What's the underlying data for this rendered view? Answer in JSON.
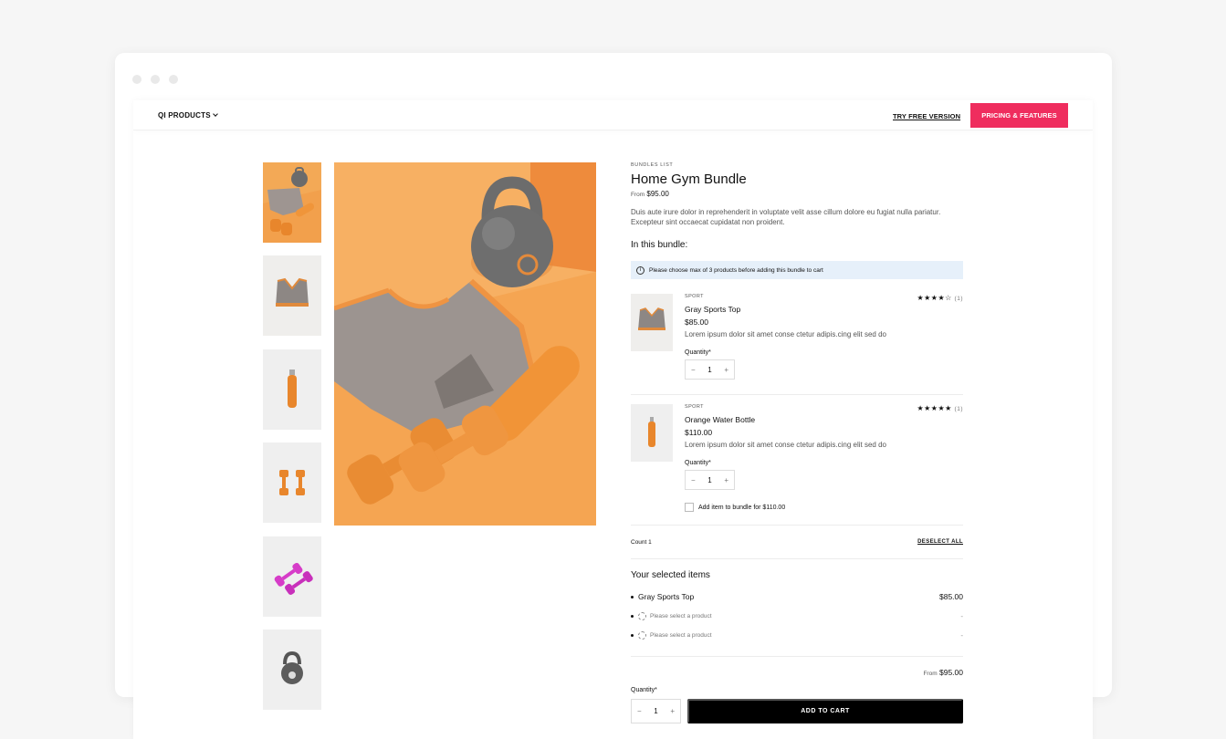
{
  "nav": {
    "products_label": "QI PRODUCTS",
    "try_free_label": "TRY FREE VERSION",
    "pricing_label": "PRICING & FEATURES",
    "accent_color": "#ef2d5e"
  },
  "gallery": {
    "thumbnails": [
      "bundle-image",
      "sports-top",
      "water-bottle",
      "orange-dumbbells",
      "pink-dumbbells",
      "kettlebell"
    ]
  },
  "product": {
    "collection": "BUNDLES LIST",
    "title": "Home Gym Bundle",
    "from_label": "From",
    "price": "$95.00",
    "description": "Duis aute irure dolor in reprehenderit in voluptate velit asse cillum dolore eu fugiat nulla pariatur. Excepteur sint occaecat cupidatat non proident.",
    "in_bundle_label": "In this bundle:",
    "notice": "Please choose max of 3 products before adding this bundle to cart"
  },
  "items": [
    {
      "category": "SPORT",
      "name": "Gray Sports Top",
      "price": "$85.00",
      "description": "Lorem ipsum dolor sit amet conse ctetur adipis.cing elit sed do",
      "quantity_label": "Quantity*",
      "quantity": "1",
      "stars": "★★★★☆",
      "rating_count": "(1)"
    },
    {
      "category": "SPORT",
      "name": "Orange Water Bottle",
      "price": "$110.00",
      "description": "Lorem ipsum dolor sit amet conse ctetur adipis.cing elit sed do",
      "quantity_label": "Quantity*",
      "quantity": "1",
      "stars": "★★★★★",
      "rating_count": "(1)",
      "add_label": "Add item to bundle for $110.00"
    }
  ],
  "summary": {
    "count_label": "Count 1",
    "deselect_label": "DESELECT ALL",
    "selected_title": "Your selected items",
    "selected": [
      {
        "name": "Gray Sports Top",
        "price": "$85.00"
      },
      {
        "name": "Please select a product",
        "price": "-"
      },
      {
        "name": "Please select a product",
        "price": "-"
      }
    ],
    "from_label": "From",
    "total": "$95.00",
    "quantity_label": "Quantity*",
    "quantity": "1",
    "minus": "−",
    "plus": "+",
    "add_to_cart_label": "ADD TO CART"
  }
}
